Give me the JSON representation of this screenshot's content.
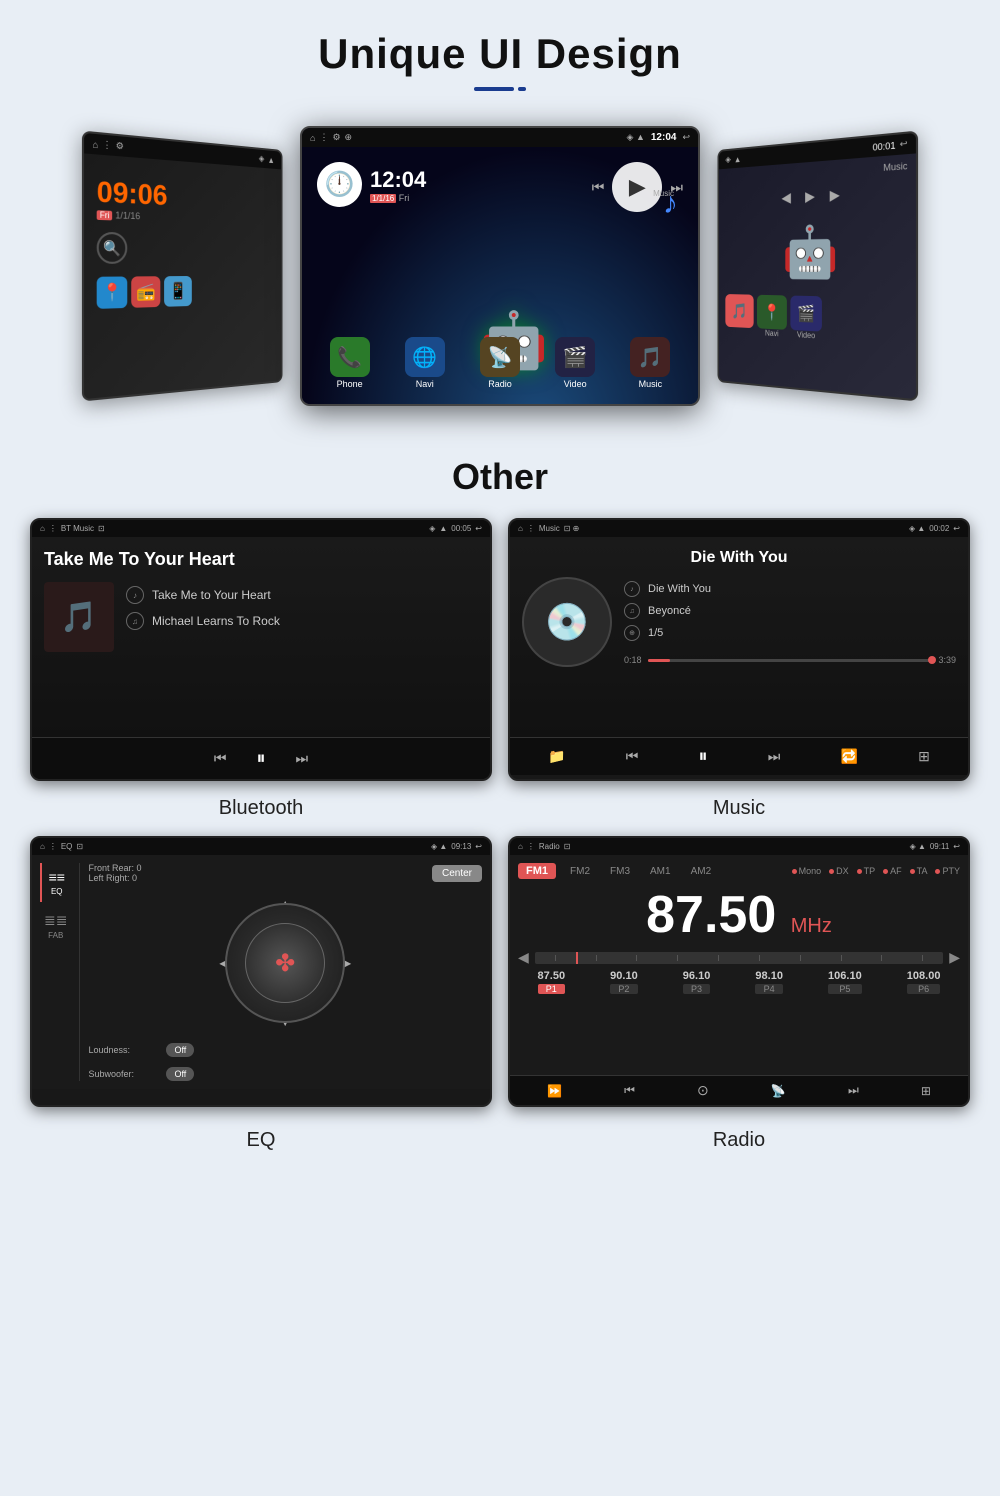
{
  "header": {
    "title": "Unique UI Design",
    "underline_long": true,
    "underline_short": true
  },
  "android_screens": {
    "left": {
      "time": "09:06",
      "date": "Fri 1/1/16",
      "apps": [
        "📍",
        "📻",
        "📱"
      ]
    },
    "center": {
      "time": "12:04",
      "date": "1/1/16 Fri",
      "app_labels": [
        "Phone",
        "Navi",
        "Radio",
        "Video",
        "Music"
      ]
    },
    "right": {
      "apps": [
        "Navi",
        "Music",
        "Video"
      ]
    }
  },
  "other_section": {
    "title": "Other"
  },
  "bluetooth_screen": {
    "status_left": "BT Music",
    "status_time": "00:05",
    "track_main_title": "Take Me To Your Heart",
    "track_name": "Take Me to Your Heart",
    "artist": "Michael Learns To Rock",
    "label": "Bluetooth"
  },
  "music_screen": {
    "status_left": "Music",
    "status_time": "00:02",
    "track_main_title": "Die With You",
    "track_name": "Die With You",
    "artist": "Beyoncé",
    "track_num": "1/5",
    "time_elapsed": "0:18",
    "time_total": "3:39",
    "progress_pct": 8,
    "label": "Music"
  },
  "eq_screen": {
    "status_left": "EQ",
    "status_time": "09:13",
    "front_rear": "Front Rear: 0",
    "left_right": "Left Right: 0",
    "loudness": "Loudness:",
    "loudness_state": "Off",
    "subwoofer": "Subwoofer:",
    "subwoofer_state": "Off",
    "center_btn": "Center",
    "sidebar": [
      "EQ",
      "FAB"
    ],
    "label": "EQ"
  },
  "radio_screen": {
    "status_left": "Radio",
    "status_time": "09:11",
    "bands": [
      "FM1",
      "FM2",
      "FM3",
      "AM1",
      "AM2"
    ],
    "active_band": "FM1",
    "options": [
      "Mono",
      "DX",
      "TP",
      "AF",
      "TA",
      "PTY"
    ],
    "frequency": "87.50",
    "unit": "MHz",
    "presets": [
      {
        "freq": "87.50",
        "num": "P1",
        "active": true
      },
      {
        "freq": "90.10",
        "num": "P2",
        "active": false
      },
      {
        "freq": "96.10",
        "num": "P3",
        "active": false
      },
      {
        "freq": "98.10",
        "num": "P4",
        "active": false
      },
      {
        "freq": "106.10",
        "num": "P5",
        "active": false
      },
      {
        "freq": "108.00",
        "num": "P6",
        "active": false
      }
    ],
    "label": "Radio"
  },
  "controls": {
    "prev": "⏮",
    "play": "⏸",
    "next": "⏭",
    "repeat": "🔁",
    "menu": "⊞"
  }
}
